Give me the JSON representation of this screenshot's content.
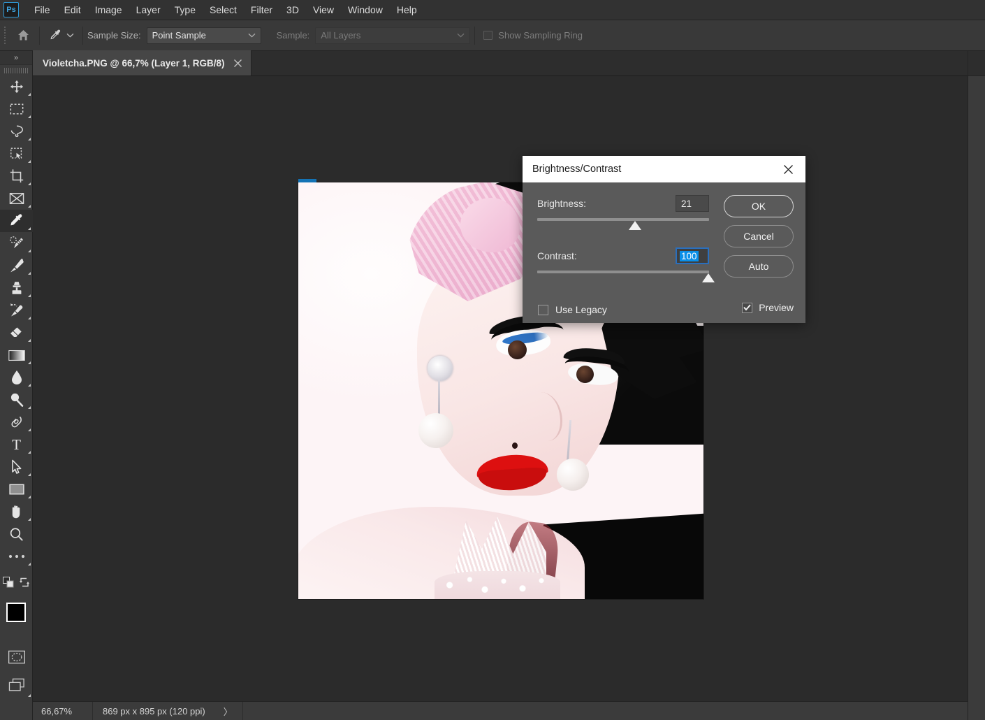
{
  "app": {
    "name": "Adobe Photoshop",
    "logo_text": "Ps"
  },
  "menubar": {
    "items": [
      {
        "label": "File"
      },
      {
        "label": "Edit"
      },
      {
        "label": "Image"
      },
      {
        "label": "Layer"
      },
      {
        "label": "Type"
      },
      {
        "label": "Select"
      },
      {
        "label": "Filter"
      },
      {
        "label": "3D"
      },
      {
        "label": "View"
      },
      {
        "label": "Window"
      },
      {
        "label": "Help"
      }
    ]
  },
  "options_bar": {
    "home_icon": "home-icon",
    "active_tool_icon": "eyedropper-icon",
    "sample_size_label": "Sample Size:",
    "sample_size_value": "Point Sample",
    "sample_label": "Sample:",
    "sample_value": "All Layers",
    "show_sampling_ring_label": "Show Sampling Ring",
    "show_sampling_ring_checked": false
  },
  "toolbar": {
    "expand_label": "»",
    "tools": [
      {
        "name": "move-tool",
        "icon": "move-icon",
        "active": false
      },
      {
        "name": "rectangular-marquee-tool",
        "icon": "marquee-icon",
        "active": false
      },
      {
        "name": "lasso-tool",
        "icon": "lasso-icon",
        "active": false
      },
      {
        "name": "object-selection-tool",
        "icon": "object-selection-icon",
        "active": false
      },
      {
        "name": "crop-tool",
        "icon": "crop-icon",
        "active": false
      },
      {
        "name": "frame-tool",
        "icon": "frame-icon",
        "active": false
      },
      {
        "name": "eyedropper-tool",
        "icon": "eyedropper-icon",
        "active": true
      },
      {
        "name": "spot-healing-brush-tool",
        "icon": "healing-brush-icon",
        "active": false
      },
      {
        "name": "brush-tool",
        "icon": "brush-icon",
        "active": false
      },
      {
        "name": "clone-stamp-tool",
        "icon": "clone-stamp-icon",
        "active": false
      },
      {
        "name": "history-brush-tool",
        "icon": "history-brush-icon",
        "active": false
      },
      {
        "name": "eraser-tool",
        "icon": "eraser-icon",
        "active": false
      },
      {
        "name": "gradient-tool",
        "icon": "gradient-icon",
        "active": false
      },
      {
        "name": "blur-tool",
        "icon": "blur-drop-icon",
        "active": false
      },
      {
        "name": "dodge-tool",
        "icon": "dodge-icon",
        "active": false
      },
      {
        "name": "pen-tool",
        "icon": "pen-icon",
        "active": false
      },
      {
        "name": "type-tool",
        "icon": "type-icon",
        "active": false
      },
      {
        "name": "path-selection-tool",
        "icon": "path-selection-arrow-icon",
        "active": false
      },
      {
        "name": "rectangle-tool",
        "icon": "rectangle-icon",
        "active": false
      },
      {
        "name": "hand-tool",
        "icon": "hand-icon",
        "active": false
      },
      {
        "name": "zoom-tool",
        "icon": "zoom-magnifier-icon",
        "active": false
      },
      {
        "name": "edit-toolbar-tool",
        "icon": "ellipsis-icon",
        "active": false
      }
    ],
    "quick_mask_icon": "quick-mask-icon",
    "screen_mode_icon": "screen-mode-icon",
    "swap_colors_icon": "swap-colors-icon",
    "default_colors_icon": "default-colors-icon",
    "foreground_color": "#000000",
    "background_color": "#ffffff"
  },
  "document": {
    "tab_title": "Violetcha.PNG @ 66,7% (Layer 1, RGB/8)",
    "close_icon": "close-icon",
    "accent_color": "#1473b5"
  },
  "dialog": {
    "title": "Brightness/Contrast",
    "close_icon": "close-icon",
    "brightness": {
      "label": "Brightness:",
      "value": "21",
      "slider_percent": 57,
      "focused": false
    },
    "contrast": {
      "label": "Contrast:",
      "value": "100",
      "slider_percent": 99,
      "focused": true
    },
    "use_legacy": {
      "label": "Use Legacy",
      "checked": false
    },
    "preview": {
      "label": "Preview",
      "checked": true
    },
    "buttons": [
      {
        "label": "OK",
        "name": "ok-button",
        "default": true
      },
      {
        "label": "Cancel",
        "name": "cancel-button",
        "default": false
      },
      {
        "label": "Auto",
        "name": "auto-button",
        "default": false
      }
    ],
    "focus_border_color": "#2a6fbd",
    "selection_color": "#0a8fe8"
  },
  "status_bar": {
    "zoom_level": "66,67%",
    "document_size": "869 px x 895 px (120 ppi)",
    "expand_arrow": "〉"
  }
}
